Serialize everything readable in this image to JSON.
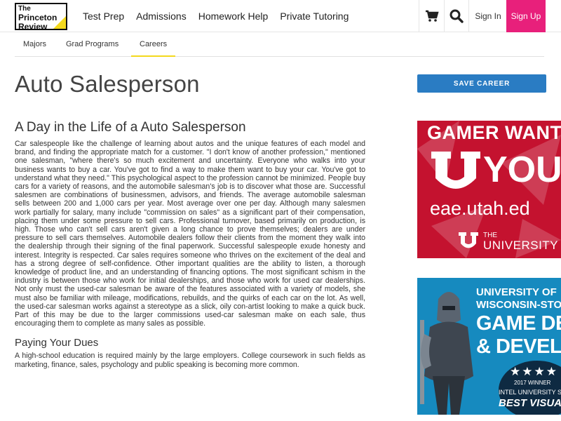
{
  "header": {
    "logo_line1": "The",
    "logo_line2": "Princeton",
    "logo_line3": "Review",
    "nav": [
      "Test Prep",
      "Admissions",
      "Homework Help",
      "Private Tutoring"
    ],
    "cart_icon": "cart-icon",
    "search_icon": "search-icon",
    "signin": "Sign In",
    "signup": "Sign Up",
    "signup_color": "#e8207b"
  },
  "subnav": {
    "tabs": [
      "Majors",
      "Grad Programs",
      "Careers"
    ],
    "active": "Careers",
    "accent": "#f4d91d"
  },
  "page": {
    "title": "Auto Salesperson",
    "save_button": "SAVE CAREER",
    "save_color": "#2a7cc3"
  },
  "article": {
    "heading": "A Day in the Life of a Auto Salesperson",
    "body": "Car salespeople like the challenge of learning about autos and the unique features of each model and brand, and finding the appropriate match for a customer. \"I don't know of another profession,\" mentioned one salesman, \"where there's so much excitement and uncertainty. Everyone who walks into your business wants to buy a car. You've got to find a way to make them want to buy your car. You've got to understand what they need.\" This psychological aspect to the profession cannot be minimized. People buy cars for a variety of reasons, and the automobile salesman's job is to discover what those are. Successful salesmen are combinations of businessmen, advisors, and friends. The average automobile salesman sells between 200 and 1,000 cars per year. Most average over one per day. Although many salesmen work partially for salary, many include \"commission on sales\" as a significant part of their compensation, placing them under some pressure to sell cars. Professional turnover, based primarily on production, is high. Those who can't sell cars aren't given a long chance to prove themselves; dealers are under pressure to sell cars themselves. Automobile dealers follow their clients from the moment they walk into the dealership through their signing of the final paperwork. Successful salespeople exude honesty and interest. Integrity is respected. Car sales requires someone who thrives on the excitement of the deal and has a strong degree of self-confidence. Other important qualities are the ability to listen, a thorough knowledge of product line, and an understanding of financing options. The most significant schism in the industry is between those who work for initial dealerships, and those who work for used car dealerships. Not only must the used-car salesman be aware of the features associated with a variety of models, she must also be familiar with mileage, modifications, rebuilds, and the quirks of each car on the lot. As well, the used-car salesman works against a stereotype as a slick, oily con-artist looking to make a quick buck. Part of this may be due to the larger commissions used-car salesman make on each sale, thus encouraging them to complete as many sales as possible.",
    "subheading": "Paying Your Dues",
    "body2": "A high-school education is required mainly by the large employers. College coursework in such fields as marketing, finance, sales, psychology and public speaking is becoming more common."
  },
  "ads": {
    "ad1": {
      "line1": "GAMER WANT",
      "line2": "YOU",
      "url": "eae.utah.ed",
      "uni_top": "THE",
      "uni": "UNIVERSITY OF UTAH®",
      "color": "#c4122f"
    },
    "ad2": {
      "line1": "UNIVERSITY OF",
      "line2": "WISCONSIN-STO",
      "line3": "GAME DESIG",
      "line4": "& DEVELOPME",
      "stars": "★★★★",
      "winner": "2017 WINNER",
      "show": "INTEL UNIVERSITY SHOW",
      "best": "BEST VISUAL A",
      "color": "#168abf"
    }
  }
}
